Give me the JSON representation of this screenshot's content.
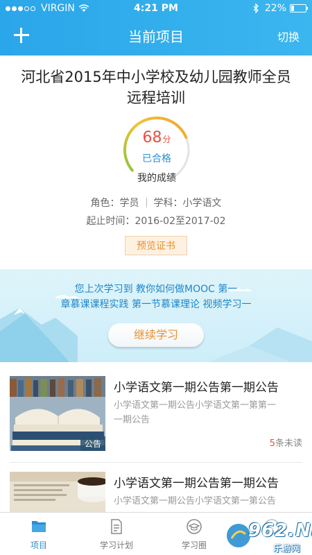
{
  "status_bar": {
    "carrier": "VIRGIN",
    "time": "4:21 PM",
    "battery": "22%",
    "battery_level": 0.22,
    "signal_bars_filled": 3,
    "signal_bars_total": 5,
    "icons": [
      "wifi-icon",
      "bluetooth-icon",
      "battery-icon"
    ]
  },
  "nav": {
    "title": "当前项目",
    "switch_label": "切换",
    "add_icon": "plus-icon"
  },
  "project": {
    "title_line1": "河北省2015年中小学校及幼儿园教师全员",
    "title_line2": "远程培训",
    "score": "68",
    "score_unit": "分",
    "score_value": 68,
    "score_max": 100,
    "pass_status": "已合格",
    "score_caption": "我的成绩",
    "role_label": "角色：学员",
    "subject_label": "学科：小学语文",
    "period_label": "起止时间：2016-02至2017-02",
    "certificate_button": "预览证书"
  },
  "banner": {
    "line1": "您上次学习到 教你如何做MOOC 第一",
    "line2": "章慕课课程实践 第一节慕课理论 视频学习一",
    "button": "继续学习"
  },
  "news": [
    {
      "title": "小学语文第一期公告第一期公告",
      "summary_line1": "小学语文第一期公告小学语文第一第第一",
      "summary_line2": "一期公告",
      "tag": "公告",
      "unread_count": "5",
      "unread_suffix": "条未读"
    },
    {
      "title": "小学语文第一期公告第一期公告",
      "summary_line1": "小学语文第一期公告小学语文第一第公告",
      "summary_line2": "",
      "tag": "",
      "unread_count": "",
      "unread_suffix": ""
    }
  ],
  "tabs": [
    {
      "label": "项目",
      "icon": "folder-icon",
      "active": true
    },
    {
      "label": "学习计划",
      "icon": "document-icon",
      "active": false
    },
    {
      "label": "学习圈",
      "icon": "graduation-cap-icon",
      "active": false
    },
    {
      "label": "",
      "icon": "more-icon",
      "active": false
    }
  ],
  "watermark": {
    "main": "962.NET",
    "sub": "乐游网"
  },
  "colors": {
    "header": "#2aa6ea",
    "accent_blue": "#2a8fd0",
    "score_red": "#e84e3f",
    "orange": "#e8902f",
    "banner_bg": "#d6f0fa"
  }
}
